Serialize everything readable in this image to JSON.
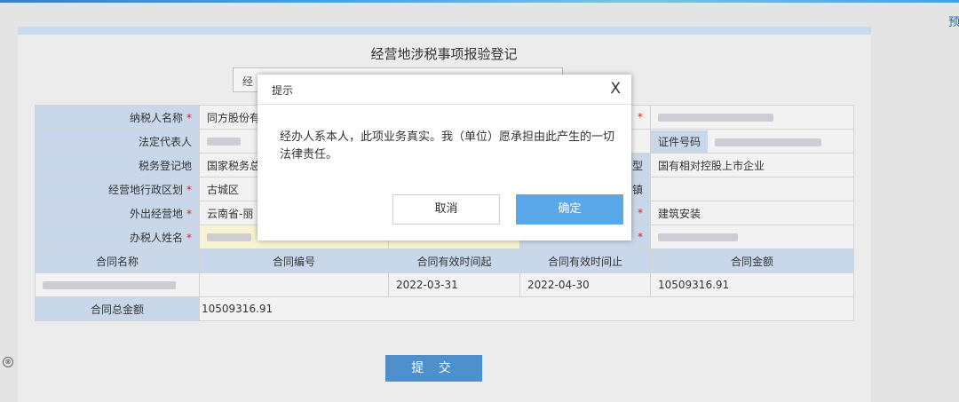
{
  "page": {
    "title": "经营地涉税事项报验登记",
    "selector_text": "经",
    "right_edge_text": "预",
    "submit_label": "提 交"
  },
  "form": {
    "taxpayer_name": {
      "label": "纳税人名称",
      "value": "同方股份有"
    },
    "legal_rep": {
      "label": "法定代表人"
    },
    "id_number": {
      "label": "证件号码"
    },
    "tax_reg_place": {
      "label": "税务登记地",
      "value": "国家税务总"
    },
    "enterprise_type": {
      "label_fragment": "型",
      "value": "国有相对控股上市企业"
    },
    "admin_district": {
      "label": "经营地行政区划",
      "value": "古城区"
    },
    "district_fragment": "镇",
    "outside_place": {
      "label": "外出经营地",
      "value": "云南省-丽"
    },
    "business_category": {
      "value": "建筑安装"
    },
    "handler_name": {
      "label": "办税人姓名"
    }
  },
  "contract_table": {
    "headers": [
      "合同名称",
      "合同编号",
      "合同有效时间起",
      "合同有效时间止",
      "合同金额"
    ],
    "row": {
      "start": "2022-03-31",
      "end": "2022-04-30",
      "amount": "10509316.91"
    },
    "total_label": "合同总金额",
    "total_value": "10509316.91"
  },
  "modal": {
    "title": "提示",
    "close": "X",
    "message": "经办人系本人，此项业务真实。我（单位）愿承担由此产生的一切法律责任。",
    "cancel_label": "取消",
    "ok_label": "确定"
  },
  "icons": {
    "close_circle": "⊗"
  }
}
